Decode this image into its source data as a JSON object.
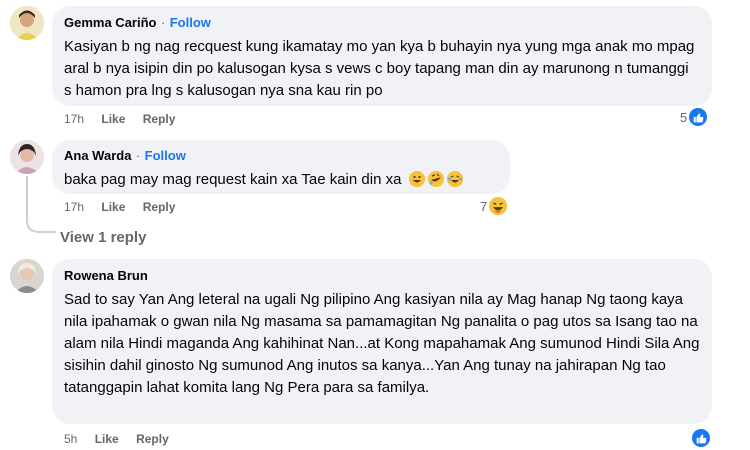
{
  "comments": [
    {
      "author": "Gemma Cariño",
      "follow": "Follow",
      "separator": "·",
      "text": "Kasiyan b ng nag recquest kung ikamatay mo yan kya b buhayin nya yung mga anak mo mpag aral b nya isipin din po kalusogan kysa s vews c boy tapang man din ay marunong n tumanggi s hamon pra lng s kalusogan nya sna kau rin po",
      "time": "17h",
      "like": "Like",
      "reply": "Reply",
      "reaction_count": "5",
      "reaction_icon": "like-icon",
      "avatar_color": "#e8d24a"
    },
    {
      "author": "Ana Warda",
      "follow": "Follow",
      "separator": "·",
      "text": "baka pag may mag request kain xa Tae kain din xa",
      "emojis": [
        "grin-emoji",
        "rofl-emoji",
        "joy-emoji"
      ],
      "time": "17h",
      "like": "Like",
      "reply": "Reply",
      "reaction_count": "7",
      "reaction_icon": "haha-icon",
      "view_replies": "View 1 reply",
      "avatar_color": "#c9a4b4"
    },
    {
      "author": "Rowena Brun",
      "text": "Sad to say Yan Ang leteral na ugali Ng pilipino Ang kasiyan nila ay Mag hanap Ng taong kaya nila ipahamak o gwan nila Ng masama sa pamamagitan Ng panalita o pag utos sa Isang tao na alam nila Hindi maganda Ang kahihinat Nan...at Kong mapahamak Ang sumunod Hindi Sila Ang sisihin dahil ginosto Ng sumunod Ang inutos sa kanya...Yan Ang tunay na jahirapan Ng tao tatanggapin lahat komita lang Ng Pera para sa familya.",
      "time": "5h",
      "like": "Like",
      "reply": "Reply",
      "reaction_icon": "like-icon",
      "avatar_color": "#b9b4ae"
    }
  ],
  "colors": {
    "link": "#1877f2",
    "bubble": "#f0f2f5",
    "meta": "#65676b"
  }
}
